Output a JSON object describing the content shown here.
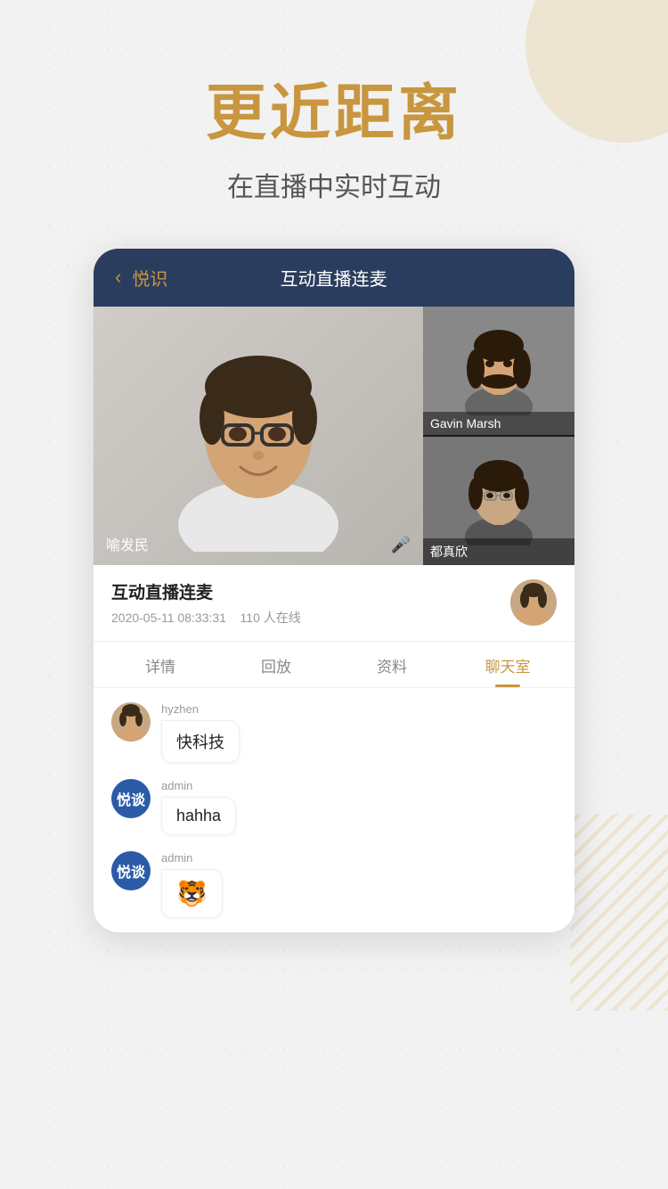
{
  "background": {
    "color": "#f2f2f2",
    "dot_pattern": true
  },
  "hero": {
    "main_title": "更近距离",
    "sub_title": "在直播中实时互动"
  },
  "app": {
    "header": {
      "back_label": "悦识",
      "title": "互动直播连麦"
    },
    "video": {
      "main_participant": {
        "name": "喻发民",
        "has_mic": true
      },
      "side_participants": [
        {
          "name": "Gavin Marsh"
        },
        {
          "name": "都真欣"
        }
      ]
    },
    "session": {
      "title": "互动直播连麦",
      "date": "2020-05-11 08:33:31",
      "online_count": "110 人在线"
    },
    "tabs": [
      {
        "label": "详情",
        "active": false
      },
      {
        "label": "回放",
        "active": false
      },
      {
        "label": "资料",
        "active": false
      },
      {
        "label": "聊天室",
        "active": true
      }
    ],
    "chat_messages": [
      {
        "avatar_type": "photo",
        "username": "hyzhen",
        "message": "快科技",
        "is_emoji": false
      },
      {
        "avatar_type": "logo",
        "username": "admin",
        "message": "hahha",
        "is_emoji": false
      },
      {
        "avatar_type": "logo",
        "username": "admin",
        "message": "🐯",
        "is_emoji": true
      }
    ],
    "logo_text": "悦谈"
  }
}
